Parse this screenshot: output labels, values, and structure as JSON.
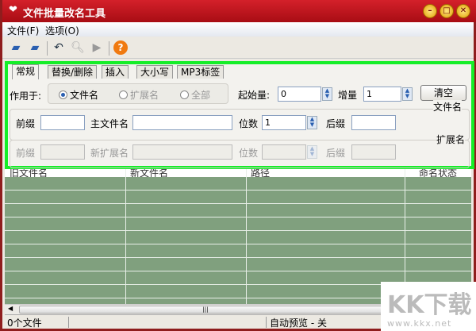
{
  "window": {
    "title": "文件批量改名工具"
  },
  "menu": [
    "文件(F)",
    "选项(O)"
  ],
  "tabs": [
    "常规",
    "替换/删除",
    "插入",
    "大小写",
    "MP3标签"
  ],
  "general": {
    "apply_to_label": "作用于:",
    "apply_options": [
      "文件名",
      "扩展名",
      "全部"
    ],
    "apply_selected": "文件名",
    "start_label": "起始量:",
    "start_value": "0",
    "increment_label": "增量",
    "increment_value": "1",
    "clear_button": "清空",
    "filename_group": "文件名",
    "prefix_label": "前缀",
    "main_name_label": "主文件名",
    "digits_label": "位数",
    "digits_value": "1",
    "suffix_label": "后缀",
    "ext_group": "扩展名",
    "ext_prefix_label": "前缀",
    "new_ext_label": "新扩展名",
    "ext_digits_label": "位数",
    "ext_suffix_label": "后缀"
  },
  "table": {
    "columns": [
      "旧文件名",
      "新文件名",
      "路径",
      "命名状态"
    ]
  },
  "status": {
    "count": "0个文件",
    "preview": "自动预览 - 关"
  },
  "watermark": {
    "text": "KK下载",
    "url": "www.kkx.net"
  }
}
